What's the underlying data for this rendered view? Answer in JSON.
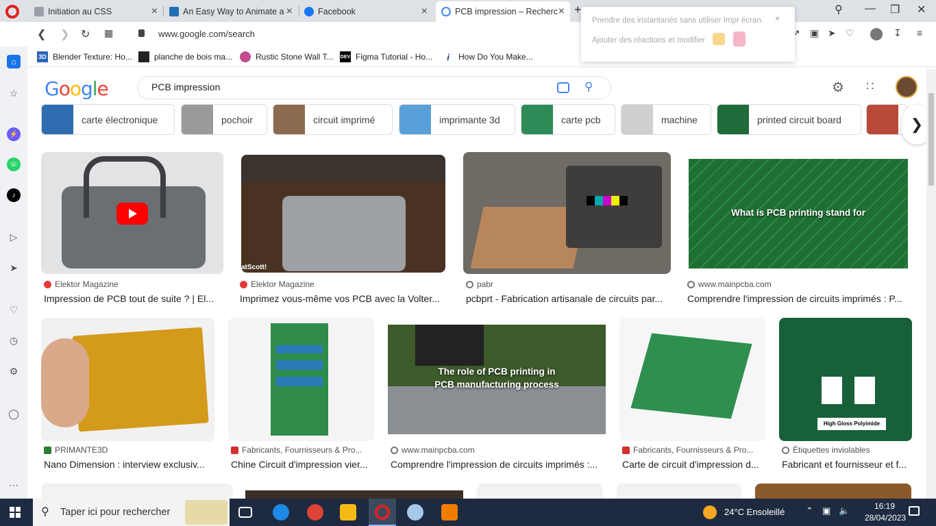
{
  "browser": {
    "tabs": [
      {
        "label": "Initiation au CSS",
        "color": "#9aa0a6"
      },
      {
        "label": "An Easy Way to Animate a",
        "color": "#1f6fb2"
      },
      {
        "label": "Facebook",
        "color": "#1877f2"
      },
      {
        "label": "PCB impression – Recherch",
        "color": "#4285f4"
      }
    ],
    "new_tab": "+",
    "url": "www.google.com/search",
    "bookmarks": [
      {
        "label": "Blender Texture: Ho...",
        "icon": "3D"
      },
      {
        "label": "planche de bois ma...",
        "icon": ""
      },
      {
        "label": "Rustic Stone Wall T...",
        "icon": ""
      },
      {
        "label": "Figma Tutorial - Ho...",
        "icon": "DEV"
      },
      {
        "label": "How Do You Make...",
        "icon": "i"
      }
    ]
  },
  "popup": {
    "line1": "Prendre des instantanés sans utiliser Impr écran.",
    "line2": "Ajouter des réactions et modifier"
  },
  "google": {
    "logo": "Google",
    "query": "PCB impression",
    "chips": [
      {
        "label": "carte électronique",
        "thumb": "#2e6db0"
      },
      {
        "label": "pochoir",
        "thumb": "#9a9a9a"
      },
      {
        "label": "circuit imprimé",
        "thumb": "#8b6a4f"
      },
      {
        "label": "imprimante 3d",
        "thumb": "#5aa0d8"
      },
      {
        "label": "carte pcb",
        "thumb": "#2e8b57"
      },
      {
        "label": "machine",
        "thumb": "#cfcfcf"
      },
      {
        "label": "printed circuit board",
        "thumb": "#1f6b3a"
      }
    ],
    "results_row1": [
      {
        "source": "Elektor Magazine",
        "title": "Impression de PCB tout de suite ? | El...",
        "bg": "#d9dadc",
        "iconColor": "#e53935"
      },
      {
        "source": "Elektor Magazine",
        "title": "Imprimez vous-même vos PCB avec la Volter...",
        "bg": "#4a3223",
        "iconColor": "#e53935",
        "overlay": "atScott!"
      },
      {
        "source": "pabr",
        "title": "pcbprt - Fabrication artisanale de circuits par...",
        "bg": "#6e6a64",
        "iconColor": "#777"
      },
      {
        "source": "www.mainpcba.com",
        "title": "Comprendre l'impression de circuits imprimés : P...",
        "bg": "#1f6f35",
        "iconColor": "#777",
        "overlay": "What is PCB printing stand for"
      }
    ],
    "results_row2": [
      {
        "source": "PRIMANTE3D",
        "title": "Nano Dimension : interview exclusiv...",
        "bg": "#d49a1a",
        "iconColor": "#2e7d32"
      },
      {
        "source": "Fabricants, Fournisseurs & Pro...",
        "title": "Chine Circuit d'impression vier...",
        "bg": "#2e8b4a",
        "iconColor": "#d32f2f"
      },
      {
        "source": "www.mainpcba.com",
        "title": "Comprendre l'impression de circuits imprimés :...",
        "bg": "#3d5a2a",
        "iconColor": "#777",
        "overlay": "The role of PCB printing in\nPCB manufacturing process"
      },
      {
        "source": "Fabricants, Fournisseurs & Pro...",
        "title": "Carte de circuit d'impression d...",
        "bg": "#2f8f4f",
        "iconColor": "#d32f2f"
      },
      {
        "source": "Étiquettes inviolables",
        "title": "Fabricant et fournisseur et f...",
        "bg": "#17603a",
        "iconColor": "#777",
        "overlay": "High Gloss Polyimide"
      }
    ]
  },
  "taskbar": {
    "search_placeholder": "Taper ici pour rechercher",
    "weather": "24°C  Ensoleillé",
    "time": "16:19",
    "date": "28/04/2023"
  }
}
